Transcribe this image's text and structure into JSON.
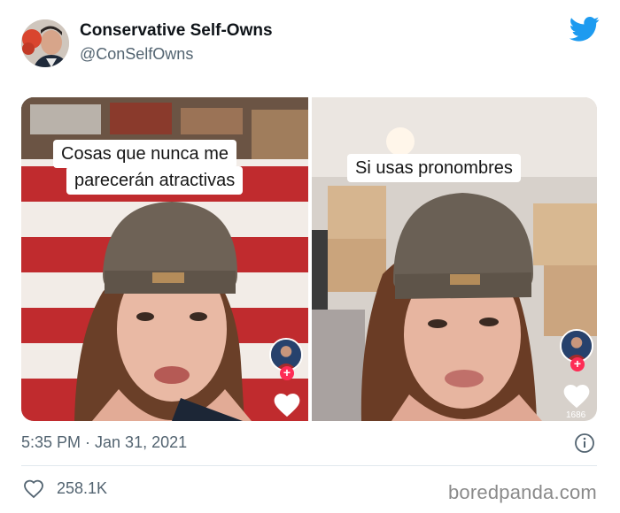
{
  "tweet": {
    "display_name": "Conservative Self-Owns",
    "handle": "@ConSelfOwns",
    "timestamp": "5:35 PM · Jan 31, 2021",
    "likes": "258.1K"
  },
  "media": {
    "left_caption_line1": "Cosas que nunca me",
    "left_caption_line2": "parecerán atractivas",
    "right_caption": "Si usas pronombres",
    "right_like_count": "1686"
  },
  "icons": {
    "brand": "twitter-bird-icon",
    "info": "info-icon",
    "like": "heart-outline-icon"
  },
  "watermark": "boredpanda.com",
  "colors": {
    "twitter_blue": "#1d9bf0",
    "muted_text": "#536471",
    "tiktok_red": "#fe2c55"
  }
}
